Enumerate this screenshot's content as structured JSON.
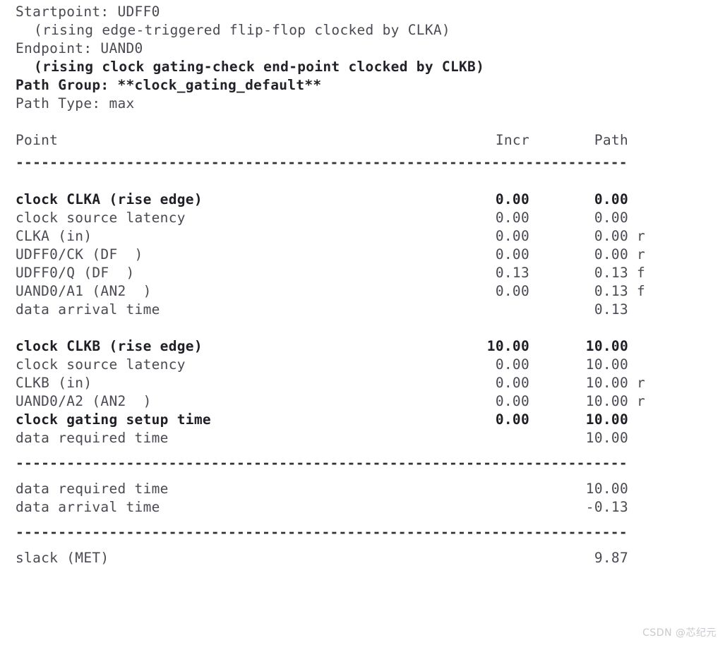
{
  "report": {
    "kind": "static-timing-analysis-path-report",
    "preamble": [
      {
        "id": "startpoint",
        "text": "Startpoint: UDFF0",
        "bold": false,
        "indent": false
      },
      {
        "id": "startpoint-detail",
        "text": "(rising edge-triggered flip-flop clocked by CLKA)",
        "bold": false,
        "indent": true
      },
      {
        "id": "endpoint",
        "text": "Endpoint: UAND0",
        "bold": false,
        "indent": false
      },
      {
        "id": "endpoint-detail",
        "text": "(rising clock gating-check end-point clocked by CLKB)",
        "bold": true,
        "indent": true
      },
      {
        "id": "path-group",
        "text": "Path Group: **clock_gating_default**",
        "bold": true,
        "indent": false
      },
      {
        "id": "path-type",
        "text": "Path Type: max",
        "bold": false,
        "indent": false
      }
    ],
    "columns": {
      "point": "Point",
      "incr": "Incr",
      "path": "Path"
    },
    "separator_char": "-",
    "separator_repeat": 72,
    "launch_block": [
      {
        "point": "clock CLKA (rise edge)",
        "incr": "0.00",
        "path": "0.00",
        "flag": "",
        "bold": true
      },
      {
        "point": "clock source latency",
        "incr": "0.00",
        "path": "0.00",
        "flag": "",
        "bold": false
      },
      {
        "point": "CLKA (in)",
        "incr": "0.00",
        "path": "0.00",
        "flag": "r",
        "bold": false
      },
      {
        "point": "UDFF0/CK (DF  )",
        "incr": "0.00",
        "path": "0.00",
        "flag": "r",
        "bold": false
      },
      {
        "point": "UDFF0/Q (DF  )",
        "incr": "0.13",
        "path": "0.13",
        "flag": "f",
        "bold": false
      },
      {
        "point": "UAND0/A1 (AN2  )",
        "incr": "0.00",
        "path": "0.13",
        "flag": "f",
        "bold": false
      },
      {
        "point": "data arrival time",
        "incr": "",
        "path": "0.13",
        "flag": "",
        "bold": false
      }
    ],
    "capture_block": [
      {
        "point": "clock CLKB (rise edge)",
        "incr": "10.00",
        "path": "10.00",
        "flag": "",
        "bold": true
      },
      {
        "point": "clock source latency",
        "incr": "0.00",
        "path": "10.00",
        "flag": "",
        "bold": false
      },
      {
        "point": "CLKB (in)",
        "incr": "0.00",
        "path": "10.00",
        "flag": "r",
        "bold": false
      },
      {
        "point": "UAND0/A2 (AN2  )",
        "incr": "0.00",
        "path": "10.00",
        "flag": "r",
        "bold": false
      },
      {
        "point": "clock gating setup time",
        "incr": "0.00",
        "path": "10.00",
        "flag": "",
        "bold": true
      },
      {
        "point": "data required time",
        "incr": "",
        "path": "10.00",
        "flag": "",
        "bold": false
      }
    ],
    "summary_block": [
      {
        "point": "data required time",
        "incr": "",
        "path": "10.00",
        "flag": "",
        "bold": false
      },
      {
        "point": "data arrival time",
        "incr": "",
        "path": "-0.13",
        "flag": "",
        "bold": false
      }
    ],
    "slack": {
      "point": "slack (MET)",
      "incr": "",
      "path": "9.87",
      "flag": "",
      "bold": false
    }
  },
  "watermark": {
    "text": "CSDN @芯纪元"
  },
  "colors": {
    "background": "#ffffff",
    "text": "#4a4a52",
    "text_bold": "#1e1e24",
    "watermark": "#c9c9cf"
  }
}
